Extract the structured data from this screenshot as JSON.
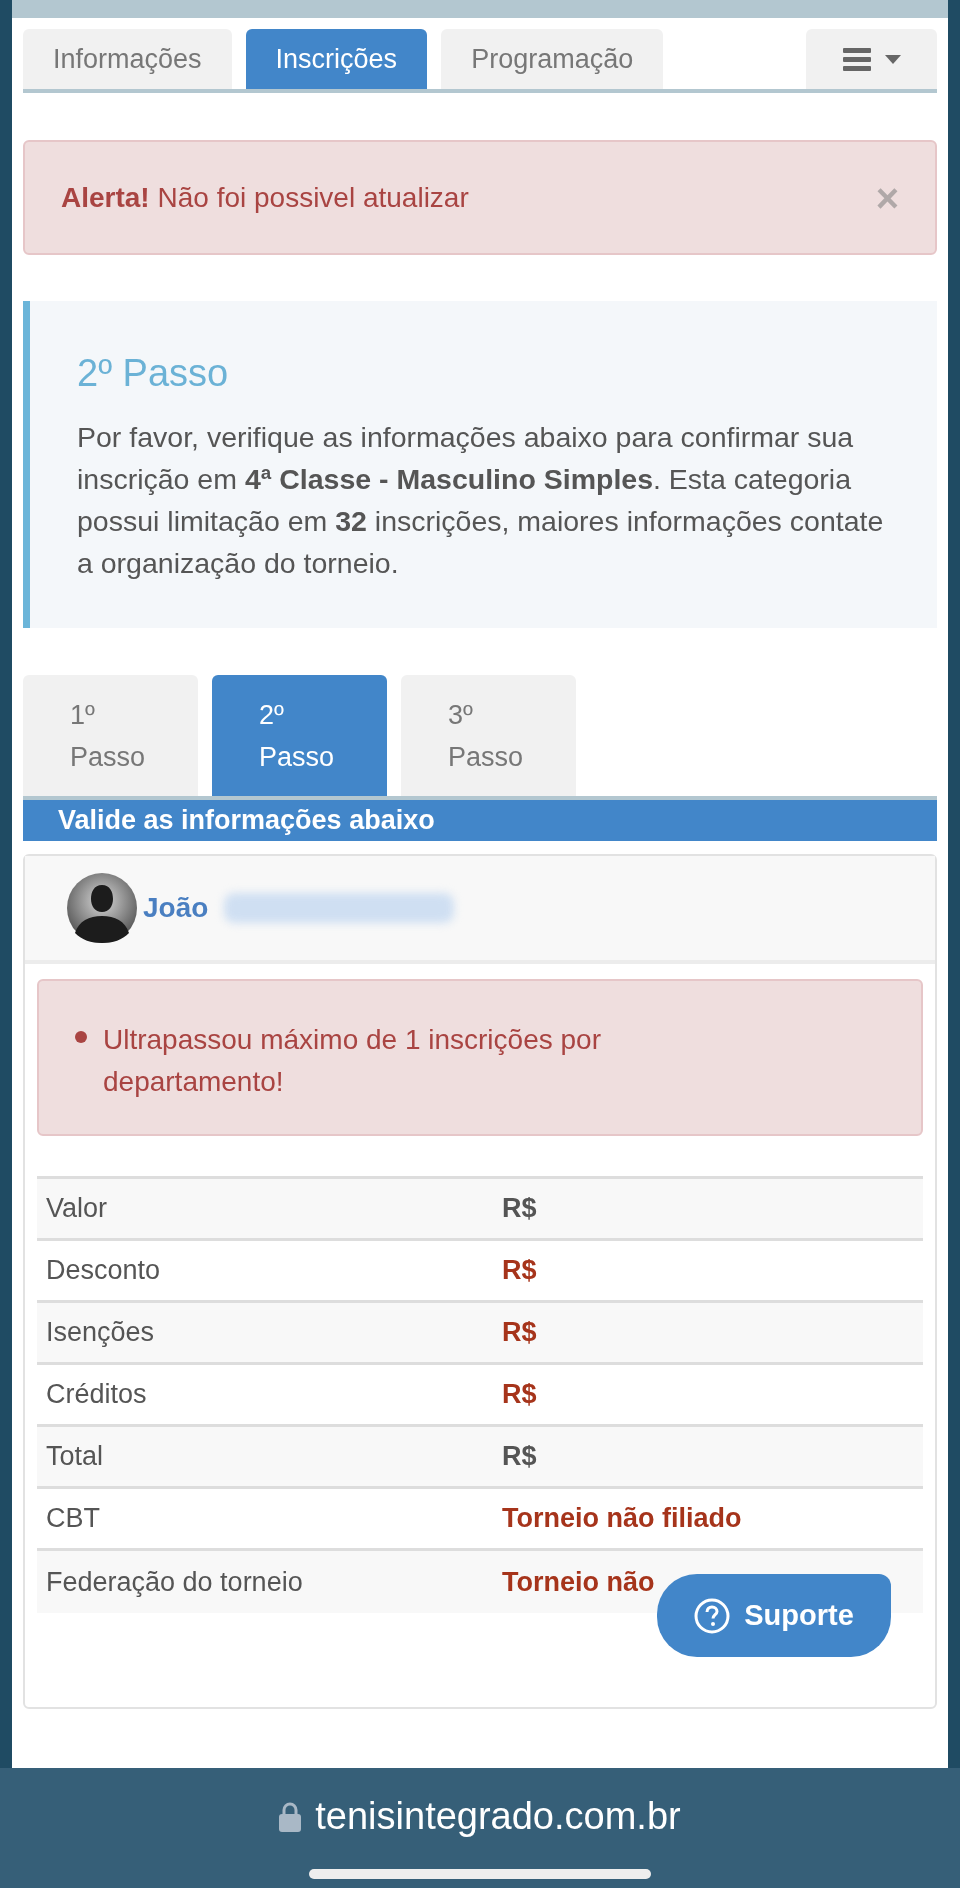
{
  "tabs": [
    {
      "label": "Informações",
      "selected": false
    },
    {
      "label": "Inscrições",
      "selected": true
    },
    {
      "label": "Programação",
      "selected": false
    }
  ],
  "alert": {
    "title": "Alerta!",
    "message": "Não foi possivel atualizar",
    "close": "×"
  },
  "step_info": {
    "title": "2º Passo",
    "text": "Por favor, verifique as informações abaixo para confirmar sua inscrição em **4ª Classe - Masculino Simples**. Esta categoria possui limitação em **32** inscrições, maiores informações contate a organização do torneio."
  },
  "steps": [
    {
      "label": "1º Passo",
      "selected": false
    },
    {
      "label": "2º Passo",
      "selected": true
    },
    {
      "label": "3º Passo",
      "selected": false
    }
  ],
  "section_title": "Valide as informações abaixo",
  "user": {
    "first_name": "João"
  },
  "errors": [
    "Ultrapassou máximo de 1 inscrições por departamento!"
  ],
  "rows": [
    {
      "label": "Valor",
      "value": "R$",
      "kind": "normal"
    },
    {
      "label": "Desconto",
      "value": "R$",
      "kind": "warning"
    },
    {
      "label": "Isenções",
      "value": "R$",
      "kind": "warning"
    },
    {
      "label": "Créditos",
      "value": "R$",
      "kind": "warning"
    },
    {
      "label": "Total",
      "value": "R$",
      "kind": "normal"
    },
    {
      "label": "CBT",
      "value": "Torneio não filiado",
      "kind": "warning"
    },
    {
      "label": "Federação do torneio",
      "value": "Torneio não",
      "kind": "warning"
    }
  ],
  "support_button": "Suporte",
  "address_bar": {
    "url": "tenisintegrado.com.br"
  }
}
